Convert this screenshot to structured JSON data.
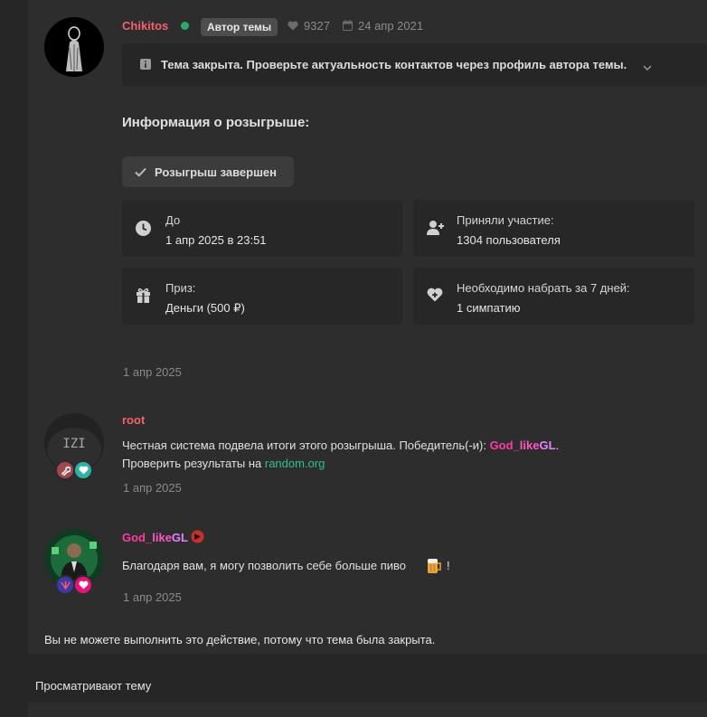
{
  "post": {
    "username": "Chikitos",
    "badge": "Автор темы",
    "likes": "9327",
    "date": "24 апр 2021",
    "notice": "Тема закрыта. Проверьте актуальность контактов через профиль автора темы."
  },
  "giveaway": {
    "heading": "Информация о розыгрыше:",
    "status": "Розыгрыш завершен",
    "cards": [
      {
        "label": "До",
        "value": "1 апр 2025 в 23:51",
        "icon": "clock-icon"
      },
      {
        "label": "Приняли участие:",
        "value": "1304 пользователя",
        "icon": "user-plus-icon"
      },
      {
        "label": "Приз:",
        "value": "Деньги (500 ₽)",
        "icon": "gift-icon"
      },
      {
        "label": "Необходимо набрать за 7 дней:",
        "value": "1 симпатию",
        "icon": "heart-plus-icon"
      }
    ],
    "date": "1 апр 2025"
  },
  "comments": [
    {
      "username": "root",
      "text_prefix": "Честная система подвела итоги этого розыгрыша. Победитель(-и): ",
      "winner_name": {
        "part1": "God_",
        "part2": "like",
        "part3": "GL"
      },
      "text_suffix": ".",
      "line2_prefix": "Проверить результаты на ",
      "link": "random.org",
      "date": "1 апр 2025",
      "avatar_text": "IZI"
    },
    {
      "username": {
        "part1": "God_",
        "part2": "like",
        "part3": "GL"
      },
      "text": "Благодаря вам, я могу позволить себе больше пиво",
      "text_suffix": "!",
      "date": "1 апр 2025"
    }
  ],
  "closed_message": "Вы не можете выполнить это действие, потому что тема была закрыта.",
  "viewers_title": "Просматривают тему",
  "colors": {
    "background": "#262626",
    "panel": "#2d2d2d",
    "accent_red": "#f2636a",
    "link_green": "#2fc28a",
    "online": "#29a96b",
    "winner_pink": "#ff3aa8"
  }
}
